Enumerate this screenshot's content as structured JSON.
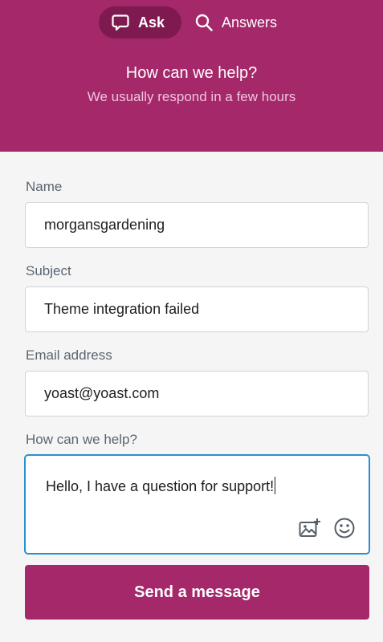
{
  "colors": {
    "brand": "#a4286a",
    "brand_dark": "#7e1a50",
    "focus_border": "#2a8fd0"
  },
  "tabs": [
    {
      "label": "Ask",
      "icon": "chat-bubble-icon",
      "active": true
    },
    {
      "label": "Answers",
      "icon": "search-icon",
      "active": false
    }
  ],
  "header": {
    "title": "How can we help?",
    "subtitle": "We usually respond in a few hours"
  },
  "form": {
    "name": {
      "label": "Name",
      "value": "morgansgardening"
    },
    "subject": {
      "label": "Subject",
      "value": "Theme integration failed"
    },
    "email": {
      "label": "Email address",
      "value": "yoast@yoast.com"
    },
    "message": {
      "label": "How can we help?",
      "value": "Hello, I have a question for support!",
      "icons": [
        "add-image-icon",
        "emoji-icon"
      ]
    },
    "submit_label": "Send a message"
  }
}
